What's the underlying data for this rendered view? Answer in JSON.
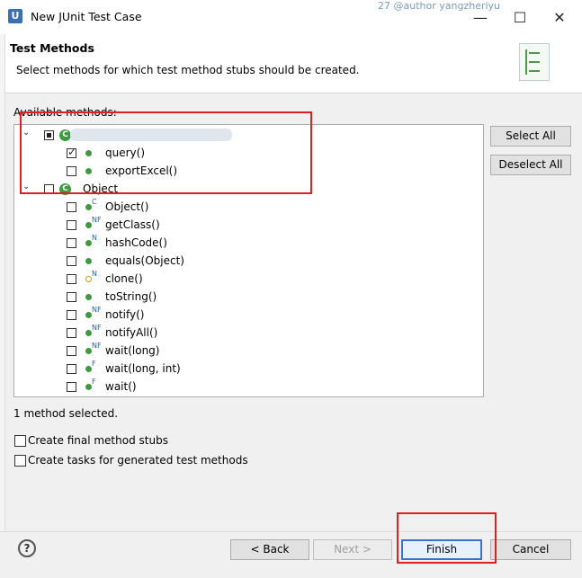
{
  "window": {
    "title": "New JUnit Test Case",
    "app_icon_letter": "U",
    "background_text": "27     @author  yangzheriyu",
    "minimize": "—",
    "maximize": "☐",
    "close": "✕"
  },
  "header": {
    "title": "Test Methods",
    "subtitle": "Select methods for which test method stubs should be created."
  },
  "available_label": "Available methods:",
  "tree": {
    "class_object": {
      "expander": "⌄",
      "icon_letter": "C",
      "label": "Object"
    },
    "class_first": {
      "expander": "⌄",
      "icon_letter": "C"
    },
    "methods_first": [
      {
        "label": "query()",
        "checked": true
      },
      {
        "label": "exportExcel()",
        "checked": false
      }
    ],
    "methods_object": [
      {
        "label": "Object()",
        "sup": "C"
      },
      {
        "label": "getClass()",
        "sup": "NF"
      },
      {
        "label": "hashCode()",
        "sup": "N"
      },
      {
        "label": "equals(Object)",
        "sup": ""
      },
      {
        "label": "clone()",
        "sup": "N"
      },
      {
        "label": "toString()",
        "sup": ""
      },
      {
        "label": "notify()",
        "sup": "NF"
      },
      {
        "label": "notifyAll()",
        "sup": "NF"
      },
      {
        "label": "wait(long)",
        "sup": "NF"
      },
      {
        "label": "wait(long, int)",
        "sup": "F"
      },
      {
        "label": "wait()",
        "sup": "F"
      }
    ],
    "scroll_up": "▲",
    "scroll_down": "▼"
  },
  "buttons": {
    "select_all": "Select All",
    "deselect_all": "Deselect All",
    "back": "< Back",
    "next": "Next >",
    "finish": "Finish",
    "cancel": "Cancel",
    "help": "?"
  },
  "status": "1 method selected.",
  "options": {
    "final_stubs": "Create final method stubs",
    "tasks": "Create tasks for generated test methods"
  },
  "colors": {
    "annotation_red": "#e02020",
    "method_green": "#3d9a3d",
    "default_button_blue": "#3a72d0"
  }
}
